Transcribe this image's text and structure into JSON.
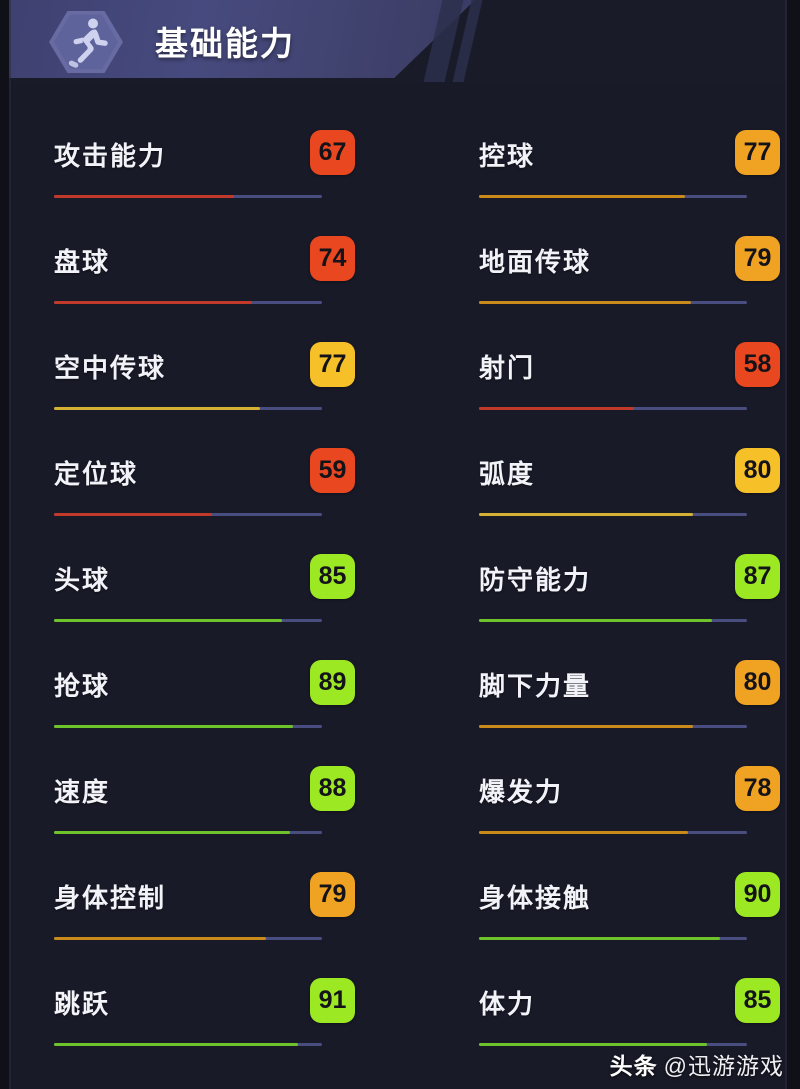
{
  "header": {
    "title": "基础能力",
    "icon": "running-figure-icon"
  },
  "colors": {
    "background": "#191a28",
    "bar_track": "#4a4d80",
    "badge_red": "#e8471f",
    "badge_orange": "#f0a322",
    "badge_amber": "#f6c028",
    "badge_green": "#9ce822",
    "fill_red": "#c0392b",
    "fill_orange": "#c98a1a",
    "fill_amber": "#d4b033",
    "fill_green": "#6fc32a"
  },
  "stats": {
    "left_column": [
      {
        "label": "攻击能力",
        "value": "67",
        "percent": 67,
        "badge_color": "#e8471f",
        "fill_color": "#c0392b",
        "text_color": "#15131a"
      },
      {
        "label": "盘球",
        "value": "74",
        "percent": 74,
        "badge_color": "#e8471f",
        "fill_color": "#c0392b",
        "text_color": "#15131a"
      },
      {
        "label": "空中传球",
        "value": "77",
        "percent": 77,
        "badge_color": "#f6c028",
        "fill_color": "#d4b033",
        "text_color": "#15131a"
      },
      {
        "label": "定位球",
        "value": "59",
        "percent": 59,
        "badge_color": "#e8471f",
        "fill_color": "#c0392b",
        "text_color": "#15131a"
      },
      {
        "label": "头球",
        "value": "85",
        "percent": 85,
        "badge_color": "#9ce822",
        "fill_color": "#6fc32a",
        "text_color": "#15131a"
      },
      {
        "label": "抢球",
        "value": "89",
        "percent": 89,
        "badge_color": "#9ce822",
        "fill_color": "#6fc32a",
        "text_color": "#15131a"
      },
      {
        "label": "速度",
        "value": "88",
        "percent": 88,
        "badge_color": "#9ce822",
        "fill_color": "#6fc32a",
        "text_color": "#15131a"
      },
      {
        "label": "身体控制",
        "value": "79",
        "percent": 79,
        "badge_color": "#f0a322",
        "fill_color": "#c98a1a",
        "text_color": "#15131a"
      },
      {
        "label": "跳跃",
        "value": "91",
        "percent": 91,
        "badge_color": "#9ce822",
        "fill_color": "#6fc32a",
        "text_color": "#15131a"
      }
    ],
    "right_column": [
      {
        "label": "控球",
        "value": "77",
        "percent": 77,
        "badge_color": "#f0a322",
        "fill_color": "#c98a1a",
        "text_color": "#15131a"
      },
      {
        "label": "地面传球",
        "value": "79",
        "percent": 79,
        "badge_color": "#f0a322",
        "fill_color": "#c98a1a",
        "text_color": "#15131a"
      },
      {
        "label": "射门",
        "value": "58",
        "percent": 58,
        "badge_color": "#e8471f",
        "fill_color": "#c0392b",
        "text_color": "#15131a"
      },
      {
        "label": "弧度",
        "value": "80",
        "percent": 80,
        "badge_color": "#f6c028",
        "fill_color": "#d4b033",
        "text_color": "#15131a"
      },
      {
        "label": "防守能力",
        "value": "87",
        "percent": 87,
        "badge_color": "#9ce822",
        "fill_color": "#6fc32a",
        "text_color": "#15131a"
      },
      {
        "label": "脚下力量",
        "value": "80",
        "percent": 80,
        "badge_color": "#f0a322",
        "fill_color": "#c98a1a",
        "text_color": "#15131a"
      },
      {
        "label": "爆发力",
        "value": "78",
        "percent": 78,
        "badge_color": "#f0a322",
        "fill_color": "#c98a1a",
        "text_color": "#15131a"
      },
      {
        "label": "身体接触",
        "value": "90",
        "percent": 90,
        "badge_color": "#9ce822",
        "fill_color": "#6fc32a",
        "text_color": "#15131a"
      },
      {
        "label": "体力",
        "value": "85",
        "percent": 85,
        "badge_color": "#9ce822",
        "fill_color": "#6fc32a",
        "text_color": "#15131a"
      }
    ]
  },
  "watermark": {
    "brand": "头条",
    "handle": "@迅游游戏"
  }
}
